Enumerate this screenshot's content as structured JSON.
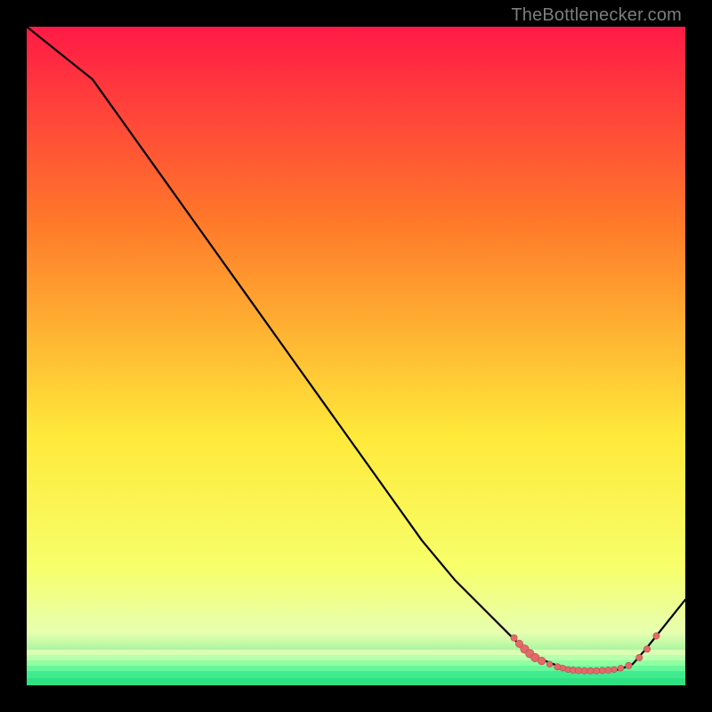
{
  "watermark": "TheBottlenecker.com",
  "colors": {
    "gradient_top": "#ff1a46",
    "gradient_mid_upper": "#ff7a2a",
    "gradient_mid": "#ffe93a",
    "gradient_lower": "#f7ff6a",
    "gradient_bottom_band_top": "#e7ffb0",
    "gradient_bottom_band_bottom": "#2fe281",
    "curve": "#000000",
    "marker_fill": "#e46a6a",
    "marker_stroke": "#b94a4a",
    "background": "#000000"
  },
  "chart_data": {
    "type": "line",
    "title": "",
    "xlabel": "",
    "ylabel": "",
    "xlim": [
      0,
      100
    ],
    "ylim": [
      0,
      100
    ],
    "series": [
      {
        "name": "bottleneck-curve",
        "x": [
          0,
          5,
          10,
          15,
          20,
          25,
          30,
          35,
          40,
          45,
          50,
          55,
          60,
          65,
          70,
          74,
          76,
          78,
          80,
          82,
          84,
          86,
          88,
          90,
          92,
          94,
          96,
          100
        ],
        "y": [
          100,
          96,
          92,
          85,
          78,
          71,
          64,
          57,
          50,
          43,
          36,
          29,
          22,
          16,
          11,
          7,
          5,
          4,
          3.2,
          2.6,
          2.3,
          2.2,
          2.2,
          2.4,
          3.2,
          5.5,
          8,
          13
        ]
      }
    ],
    "markers": {
      "name": "sampled-points",
      "points": [
        {
          "x": 74.0,
          "y": 7.2,
          "r": 2.6
        },
        {
          "x": 74.8,
          "y": 6.3,
          "r": 3.0
        },
        {
          "x": 75.6,
          "y": 5.5,
          "r": 3.4
        },
        {
          "x": 76.4,
          "y": 4.8,
          "r": 3.4
        },
        {
          "x": 77.2,
          "y": 4.2,
          "r": 3.4
        },
        {
          "x": 78.2,
          "y": 3.7,
          "r": 3.1
        },
        {
          "x": 79.4,
          "y": 3.2,
          "r": 2.4
        },
        {
          "x": 80.6,
          "y": 2.8,
          "r": 2.6
        },
        {
          "x": 81.4,
          "y": 2.6,
          "r": 2.4
        },
        {
          "x": 82.2,
          "y": 2.4,
          "r": 2.4
        },
        {
          "x": 83.0,
          "y": 2.3,
          "r": 2.6
        },
        {
          "x": 83.8,
          "y": 2.25,
          "r": 2.6
        },
        {
          "x": 84.7,
          "y": 2.2,
          "r": 2.6
        },
        {
          "x": 85.6,
          "y": 2.2,
          "r": 2.6
        },
        {
          "x": 86.5,
          "y": 2.2,
          "r": 2.6
        },
        {
          "x": 87.4,
          "y": 2.25,
          "r": 2.6
        },
        {
          "x": 88.3,
          "y": 2.3,
          "r": 2.6
        },
        {
          "x": 89.2,
          "y": 2.4,
          "r": 2.4
        },
        {
          "x": 90.2,
          "y": 2.6,
          "r": 2.4
        },
        {
          "x": 91.4,
          "y": 3.0,
          "r": 2.6
        },
        {
          "x": 93.0,
          "y": 4.2,
          "r": 2.6
        },
        {
          "x": 94.2,
          "y": 5.5,
          "r": 2.6
        },
        {
          "x": 95.6,
          "y": 7.5,
          "r": 2.6
        }
      ]
    }
  }
}
